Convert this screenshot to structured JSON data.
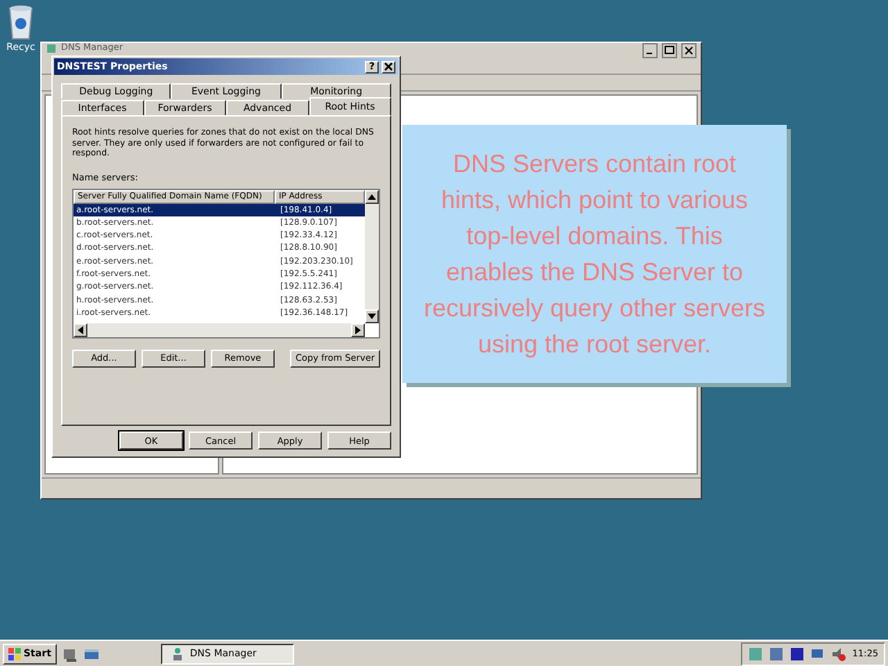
{
  "desktop_icons": [
    {
      "label": "Recyc"
    }
  ],
  "main_window": {
    "title": "DNS Manager"
  },
  "dialog": {
    "title": "DNSTEST Properties",
    "help": "?",
    "tabs_back": [
      {
        "label": "Debug Logging",
        "selected": false
      },
      {
        "label": "Event Logging",
        "selected": false
      },
      {
        "label": "Monitoring",
        "selected": false
      }
    ],
    "tabs_front": [
      {
        "label": "Interfaces",
        "selected": false
      },
      {
        "label": "Forwarders",
        "selected": false
      },
      {
        "label": "Advanced",
        "selected": false
      },
      {
        "label": "Root Hints",
        "selected": true
      }
    ],
    "description": "Root hints resolve queries for zones that do not exist on the local DNS server.  They are only used if forwarders are not configured or fail to respond.",
    "list_label": "Name servers:",
    "columns": [
      "Server Fully Qualified Domain Name (FQDN)",
      "IP Address"
    ],
    "rows": [
      {
        "fqdn": "a.root-servers.net.",
        "ip": "[198.41.0.4]",
        "selected": true
      },
      {
        "fqdn": "b.root-servers.net.",
        "ip": "[128.9.0.107]",
        "selected": false
      },
      {
        "fqdn": "c.root-servers.net.",
        "ip": "[192.33.4.12]",
        "selected": false
      },
      {
        "fqdn": "d.root-servers.net.",
        "ip": "[128.8.10.90]",
        "selected": false
      },
      {
        "fqdn": "e.root-servers.net.",
        "ip": "[192.203.230.10]",
        "selected": false
      },
      {
        "fqdn": "f.root-servers.net.",
        "ip": "[192.5.5.241]",
        "selected": false
      },
      {
        "fqdn": "g.root-servers.net.",
        "ip": "[192.112.36.4]",
        "selected": false
      },
      {
        "fqdn": "h.root-servers.net.",
        "ip": "[128.63.2.53]",
        "selected": false
      },
      {
        "fqdn": "i.root-servers.net.",
        "ip": "[192.36.148.17]",
        "selected": false
      }
    ],
    "list_buttons": [
      "Add...",
      "Edit...",
      "Remove",
      "Copy from Server"
    ],
    "buttons": [
      "OK",
      "Cancel",
      "Apply",
      "Help"
    ]
  },
  "callout": {
    "text": "DNS Servers contain root hints, which point to various top-level domains. This enables the DNS Server to recursively query other servers using the root server."
  },
  "taskbar": {
    "start": "Start",
    "tasks": [
      {
        "label": "DNS Manager",
        "selected": true
      }
    ],
    "clock": "11:25"
  }
}
